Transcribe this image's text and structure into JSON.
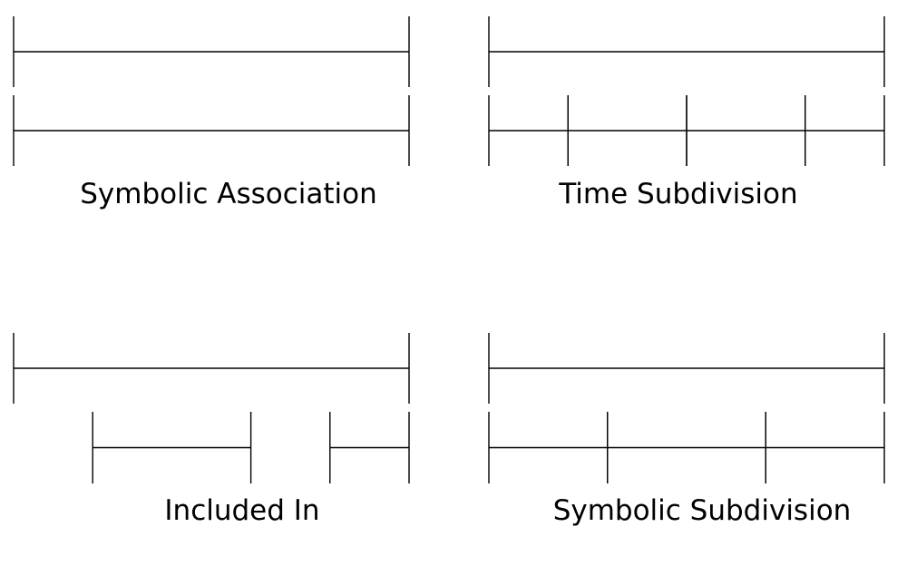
{
  "panels": [
    {
      "caption": "Symbolic Association",
      "rows": [
        {
          "segments": [
            [
              0,
              1
            ]
          ]
        },
        {
          "segments": [
            [
              0,
              1
            ]
          ]
        }
      ]
    },
    {
      "caption": "Time Subdivision",
      "rows": [
        {
          "segments": [
            [
              0,
              1
            ]
          ]
        },
        {
          "segments": [
            [
              0,
              0.2
            ],
            [
              0.2,
              0.5
            ],
            [
              0.5,
              0.8
            ],
            [
              0.8,
              1
            ]
          ]
        }
      ]
    },
    {
      "caption": "Included In",
      "rows": [
        {
          "segments": [
            [
              0,
              1
            ]
          ]
        },
        {
          "segments": [
            [
              0.2,
              0.6
            ],
            [
              0.8,
              1
            ]
          ]
        }
      ]
    },
    {
      "caption": "Symbolic Subdivision",
      "rows": [
        {
          "segments": [
            [
              0,
              1
            ]
          ]
        },
        {
          "segments": [
            [
              0,
              0.3
            ],
            [
              0.3,
              0.7
            ],
            [
              0.7,
              1
            ]
          ]
        }
      ]
    }
  ],
  "colors": {
    "line": "#000000",
    "background": "#ffffff"
  }
}
